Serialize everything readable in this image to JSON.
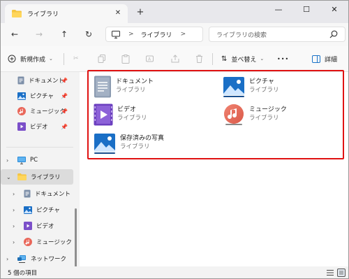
{
  "window": {
    "tab_title": "ライブラリ",
    "tab_close": "✕",
    "new_tab": "+",
    "minimize": "—",
    "maximize": "☐",
    "close": "✕"
  },
  "address": {
    "breadcrumb": "ライブラリ",
    "separator": ">",
    "search_placeholder": "ライブラリの検索"
  },
  "toolbar": {
    "new_label": "新規作成",
    "sort_label": "並べ替え",
    "more_label": "•••",
    "details_label": "詳細"
  },
  "sidebar": {
    "quick_access": [
      {
        "label": "ドキュメント",
        "icon": "documents-icon"
      },
      {
        "label": "ピクチャ",
        "icon": "pictures-icon"
      },
      {
        "label": "ミュージック",
        "icon": "music-icon"
      },
      {
        "label": "ビデオ",
        "icon": "videos-icon"
      }
    ],
    "tree": [
      {
        "label": "PC",
        "icon": "pc-icon"
      },
      {
        "label": "ライブラリ",
        "icon": "folder-icon"
      },
      {
        "label": "ドキュメント",
        "icon": "documents-icon"
      },
      {
        "label": "ピクチャ",
        "icon": "pictures-icon"
      },
      {
        "label": "ビデオ",
        "icon": "videos-icon"
      },
      {
        "label": "ミュージック",
        "icon": "music-icon"
      },
      {
        "label": "ネットワーク",
        "icon": "network-icon"
      }
    ]
  },
  "content": {
    "items": [
      {
        "name": "ドキュメント",
        "type": "ライブラリ"
      },
      {
        "name": "ピクチャ",
        "type": "ライブラリ"
      },
      {
        "name": "ビデオ",
        "type": "ライブラリ"
      },
      {
        "name": "ミュージック",
        "type": "ライブラリ"
      },
      {
        "name": "保存済みの写真",
        "type": "ライブラリ"
      }
    ]
  },
  "status": {
    "count_text": "5 個の項目"
  },
  "colors": {
    "selection_border": "#e01212",
    "folder_yellow": "#f5c542",
    "accent_blue": "#1a73c8"
  }
}
